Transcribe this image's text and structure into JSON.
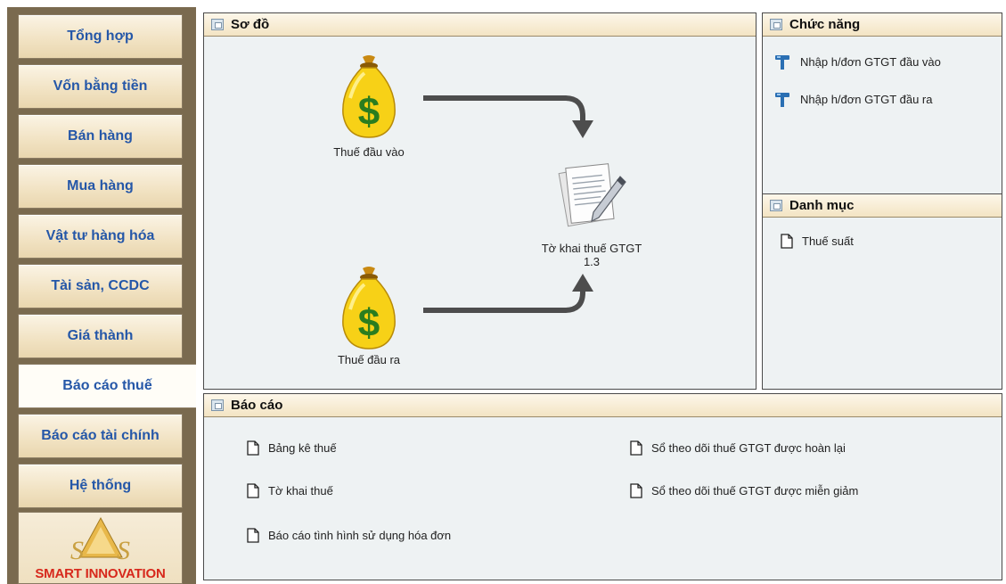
{
  "nav": {
    "items": [
      {
        "label": "Tổng hợp"
      },
      {
        "label": "Vốn bằng tiền"
      },
      {
        "label": "Bán hàng"
      },
      {
        "label": "Mua hàng"
      },
      {
        "label": "Vật tư hàng hóa"
      },
      {
        "label": "Tài sản, CCDC"
      },
      {
        "label": "Giá thành"
      },
      {
        "label": "Báo cáo thuế"
      },
      {
        "label": "Báo cáo tài chính"
      },
      {
        "label": "Hệ thống"
      }
    ],
    "active_index": 7,
    "logo_text": "SMART INNOVATION"
  },
  "diagram": {
    "title": "Sơ đồ",
    "input_tax_label": "Thuế đầu vào",
    "output_tax_label": "Thuế đầu ra",
    "declaration_label": "Tờ khai thuế GTGT",
    "declaration_version": "1.3"
  },
  "functions": {
    "title": "Chức năng",
    "items": [
      {
        "label": "Nhập h/đơn GTGT đầu vào",
        "icon": "hammer-icon"
      },
      {
        "label": "Nhập h/đơn GTGT đầu ra",
        "icon": "hammer-icon"
      }
    ]
  },
  "catalog": {
    "title": "Danh mục",
    "items": [
      {
        "label": "Thuế suất",
        "icon": "document-icon"
      }
    ]
  },
  "reports": {
    "title": "Báo cáo",
    "left": [
      {
        "label": "Bảng kê thuế"
      },
      {
        "label": "Tờ khai thuế"
      },
      {
        "label": "Báo cáo tình hình sử dụng hóa đơn"
      }
    ],
    "right": [
      {
        "label": "Sổ theo dõi thuế GTGT được hoàn lại"
      },
      {
        "label": "Sổ theo dõi thuế GTGT được miễn giảm"
      }
    ]
  },
  "colors": {
    "nav_text": "#2557a8",
    "logo_red": "#d7281c",
    "panel_bg": "#eef2f3",
    "header_bg": "#f3e4c3"
  }
}
